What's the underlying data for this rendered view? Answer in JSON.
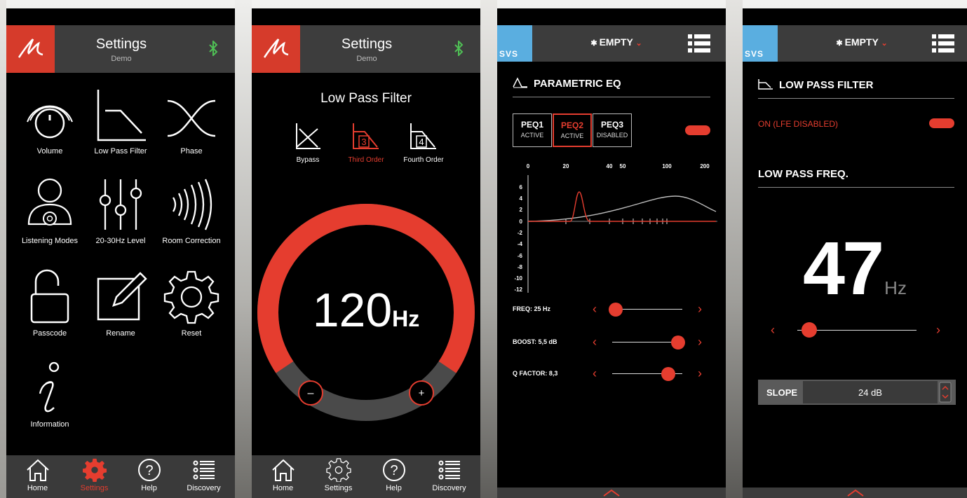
{
  "screen1": {
    "header": {
      "title": "Settings",
      "subtitle": "Demo"
    },
    "grid": [
      {
        "label": "Volume",
        "icon": "volume-knob-icon"
      },
      {
        "label": "Low Pass Filter",
        "icon": "low-pass-filter-icon"
      },
      {
        "label": "Phase",
        "icon": "phase-icon"
      },
      {
        "label": "Listening Modes",
        "icon": "listening-modes-icon"
      },
      {
        "label": "20-30Hz Level",
        "icon": "level-sliders-icon"
      },
      {
        "label": "Room Correction",
        "icon": "room-correction-icon"
      },
      {
        "label": "Passcode",
        "icon": "padlock-icon"
      },
      {
        "label": "Rename",
        "icon": "rename-icon"
      },
      {
        "label": "Reset",
        "icon": "gear-icon"
      },
      {
        "label": "Information",
        "icon": "information-icon"
      }
    ],
    "tabs": [
      {
        "label": "Home",
        "icon": "home-icon"
      },
      {
        "label": "Settings",
        "icon": "gear-icon"
      },
      {
        "label": "Help",
        "icon": "help-icon"
      },
      {
        "label": "Discovery",
        "icon": "list-icon"
      }
    ]
  },
  "screen2": {
    "header": {
      "title": "Settings",
      "subtitle": "Demo"
    },
    "title": "Low Pass Filter",
    "modes": [
      {
        "label": "Bypass",
        "icon": "bypass-icon",
        "active": false
      },
      {
        "label": "Third Order",
        "icon": "third-order-icon",
        "num": "3",
        "active": true
      },
      {
        "label": "Fourth Order",
        "icon": "fourth-order-icon",
        "num": "4",
        "active": false
      }
    ],
    "freq_value": "120",
    "freq_unit": "Hz",
    "dial_fraction": 0.8,
    "minus_label": "–",
    "plus_label": "+",
    "tabs": [
      {
        "label": "Home"
      },
      {
        "label": "Settings"
      },
      {
        "label": "Help"
      },
      {
        "label": "Discovery"
      }
    ]
  },
  "screen3": {
    "header": {
      "logo": "SVS",
      "preset": "EMPTY"
    },
    "section": "PARAMETRIC EQ",
    "segments": [
      {
        "name": "PEQ1",
        "status": "ACTIVE",
        "selected": false
      },
      {
        "name": "PEQ2",
        "status": "ACTIVE",
        "selected": true
      },
      {
        "name": "PEQ3",
        "status": "DISABLED",
        "selected": false
      }
    ],
    "graph": {
      "x_ticks": [
        "0",
        "20",
        "40",
        "50",
        "100",
        "200"
      ],
      "y_ticks": [
        "6",
        "4",
        "2",
        "0",
        "-2",
        "-4",
        "-6",
        "-8",
        "-10",
        "-12"
      ]
    },
    "sliders": [
      {
        "label": "FREQ: 25 Hz",
        "value": 0.05
      },
      {
        "label": "BOOST: 5,5 dB",
        "value": 0.94
      },
      {
        "label": "Q FACTOR: 8,3",
        "value": 0.8
      }
    ],
    "colors": {
      "accent": "#e53d2f",
      "logo_bg": "#5aaee0"
    }
  },
  "screen4": {
    "header": {
      "logo": "SVS",
      "preset": "EMPTY"
    },
    "section": "LOW PASS FILTER",
    "on_label": "ON (LFE DISABLED)",
    "freq_section": "LOW PASS FREQ.",
    "freq_value": "47",
    "freq_unit": "Hz",
    "slider_value": 0.1,
    "slope_label": "SLOPE",
    "slope_value": "24 dB"
  }
}
